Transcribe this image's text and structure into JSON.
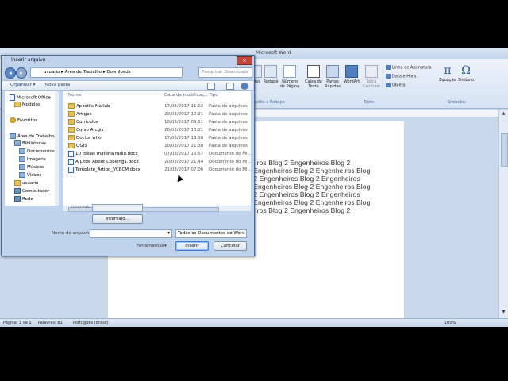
{
  "word": {
    "title": "Microsoft Word",
    "ribbon": {
      "items": [
        "ho",
        "Rodapé",
        "Número de Página",
        "Caixa de Texto",
        "Partes Rápidas",
        "WordArt",
        "Letra Capitular",
        "Equação",
        "Símbolo"
      ],
      "side_items": [
        "Linha de Assinatura",
        "Data e Hora",
        "Objeto"
      ],
      "groups": [
        "ençalho e Rodapé",
        "Texto",
        "Símbolos"
      ]
    },
    "document_lines": [
      "heiros  Blog  2  Engenheiros  Blog  2",
      "2 Engenheiros Blog 2 Engenheiros Blog",
      "g 2 Engenheiros Blog 2 Engenheiros",
      "2 Engenheiros Blog 2 Engenheiros Blog",
      "g 2 Engenheiros Blog 2 Engenheiros",
      "2 Engenheiros Blog 2 Engenheiros Blog",
      "heiros  Blog  2  Engenheiros  Blog  2"
    ],
    "status": {
      "page": "Página: 1 de 1",
      "words": "Palavras: 81",
      "language": "Português (Brasil)",
      "zoom": "100%"
    }
  },
  "dialog": {
    "title": "Inserir arquivo",
    "close_label": "✕",
    "breadcrumb": [
      "usuario",
      "Área de Trabalho",
      "Downloads"
    ],
    "search_placeholder": "Pesquisar Downloads",
    "toolbar": {
      "organize": "Organizar ▾",
      "new_folder": "Nova pasta"
    },
    "nav": [
      {
        "label": "Microsoft Office",
        "icon": "word-icon"
      },
      {
        "label": "Modelos",
        "icon": "folder-icon"
      },
      {
        "label": "Favoritos",
        "icon": "star-icon"
      },
      {
        "label": "Área de Trabalho",
        "icon": "desktop-icon"
      },
      {
        "label": "Bibliotecas",
        "icon": "library-icon"
      },
      {
        "label": "Documentos",
        "icon": "library-icon"
      },
      {
        "label": "Imagens",
        "icon": "library-icon"
      },
      {
        "label": "Músicas",
        "icon": "library-icon"
      },
      {
        "label": "Vídeos",
        "icon": "library-icon"
      },
      {
        "label": "usuario",
        "icon": "user-icon"
      },
      {
        "label": "Computador",
        "icon": "computer-icon"
      },
      {
        "label": "Rede",
        "icon": "network-icon"
      }
    ],
    "columns": [
      "Nome",
      "Data de modificaç...",
      "Tipo"
    ],
    "files": [
      {
        "name": "Apostila Matlab",
        "date": "17/03/2017 11:02",
        "type": "Pasta de arquivos",
        "icon": "folder-icon"
      },
      {
        "name": "Artigos",
        "date": "20/03/2017 10:21",
        "type": "Pasta de arquivos",
        "icon": "folder-icon"
      },
      {
        "name": "Curriculos",
        "date": "10/03/2017 09:21",
        "type": "Pasta de arquivos",
        "icon": "folder-icon"
      },
      {
        "name": "Curso Arcgis",
        "date": "20/03/2017 10:21",
        "type": "Pasta de arquivos",
        "icon": "folder-icon"
      },
      {
        "name": "Doctor who",
        "date": "17/06/2017 13:30",
        "type": "Pasta de arquivos",
        "icon": "folder-icon"
      },
      {
        "name": "QGIS",
        "date": "20/03/2017 21:38",
        "type": "Pasta de arquivos",
        "icon": "folder-icon"
      },
      {
        "name": "10 Idéias matéria radio.docx",
        "date": "07/03/2017 16:57",
        "type": "Documento do Mi...",
        "icon": "docx-icon"
      },
      {
        "name": "A Little About Cooking1.docx",
        "date": "20/03/2017 21:44",
        "type": "Documento do Mi...",
        "icon": "docx-icon"
      },
      {
        "name": "Template_Artigo_VCBCM.docx",
        "date": "21/03/2017 07:06",
        "type": "Documento do Mi...",
        "icon": "docx-icon"
      }
    ],
    "interval_label": "Intervalo:",
    "interval_button": "Intervalo...",
    "filename_label": "Nome do arquivo:",
    "filename_value": "",
    "filetype_value": "Todos os Documentos do Word",
    "tools_label": "Ferramentas",
    "insert_label": "Inserir",
    "cancel_label": "Cancelar"
  }
}
